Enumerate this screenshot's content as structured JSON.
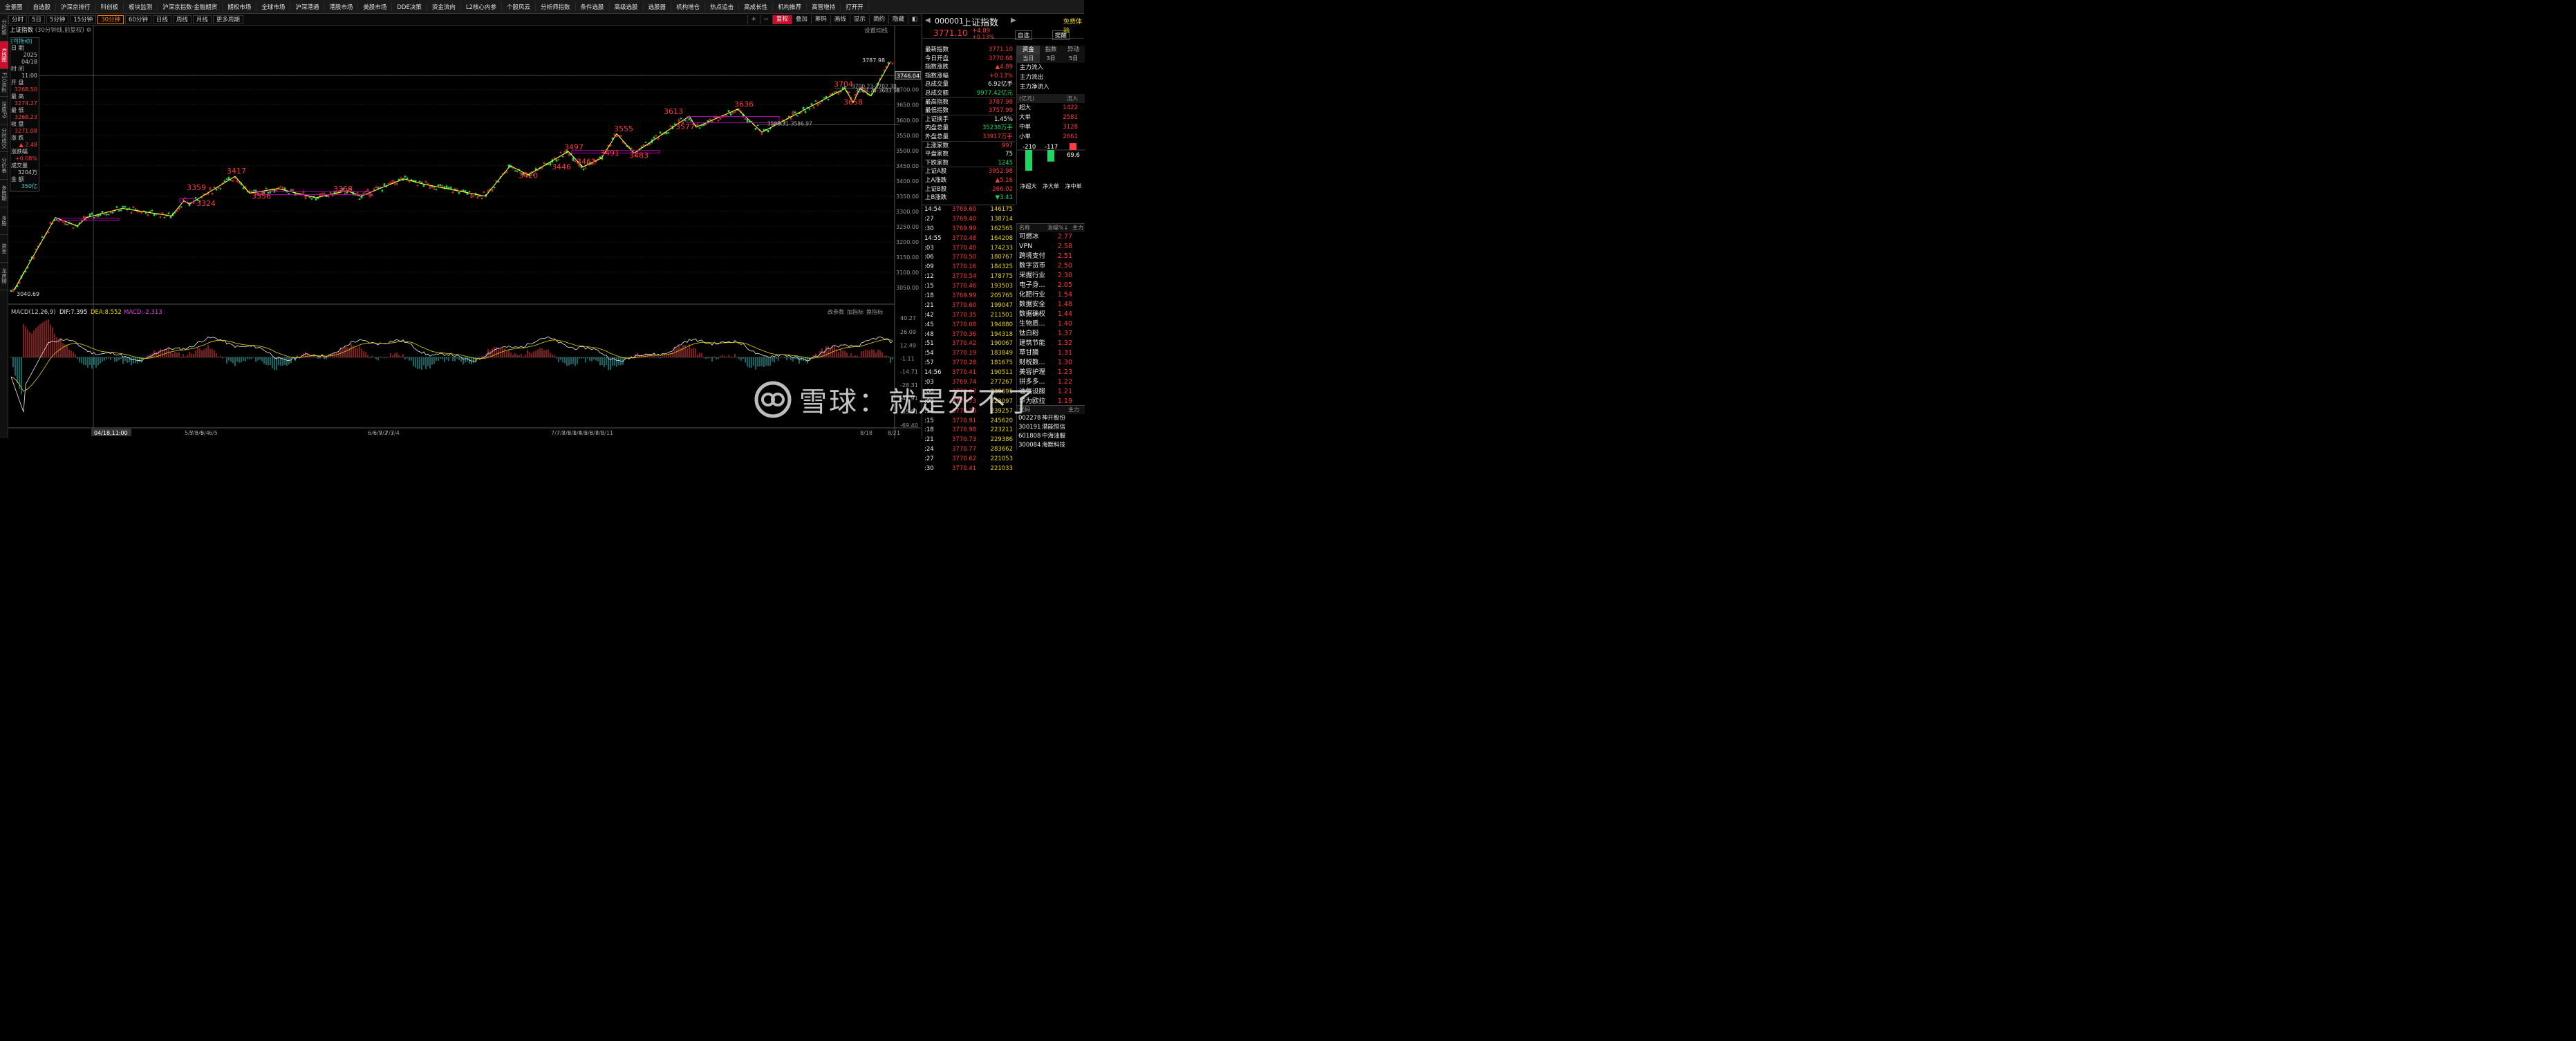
{
  "app": {
    "logo": "东方财富"
  },
  "menu": [
    "全景图",
    "自选股",
    "沪深京排行",
    "科创板",
    "板块监测",
    "沪深京指数·金融期货",
    "期权市场",
    "全球市场",
    "沪深港通",
    "港股市场",
    "美股市场",
    "DDE决策",
    "资金流向",
    "L2核心内参",
    "个股风云",
    "分析师指数",
    "条件选股",
    "高级选股",
    "选股器",
    "机构增仓",
    "热点追击",
    "高成长性",
    "机构推荐",
    "高管增持",
    "打开开"
  ],
  "side_tabs": [
    "分时图",
    "K线图",
    "F10资料",
    "深度F9",
    "分时成交",
    "分价表",
    "多周期",
    "多股",
    "资金",
    "龙虎榜"
  ],
  "periods": [
    "分时",
    "5日",
    "5分钟",
    "15分钟",
    "30分钟",
    "60分钟",
    "日线",
    "周线",
    "月线",
    "更多周期"
  ],
  "active_period": "30分钟",
  "tools": [
    "复权",
    "叠加",
    "筹码",
    "画线",
    "显示",
    "简约",
    "隐藏"
  ],
  "chart_title": "上证指数",
  "chart_subtitle": "(30分钟线,前复权)",
  "settings_label": "设置均线",
  "infobox": {
    "drag": "[可拖动]",
    "date_label": "日 期",
    "date_year": "2025",
    "date_md": "04/18",
    "time_label": "时 间",
    "time": "11:00",
    "open_label": "开 盘",
    "open": "3268.50",
    "high_label": "最 高",
    "high": "3274.27",
    "low_label": "最 低",
    "low": "3268.23",
    "close_label": "收 盘",
    "close": "3271.08",
    "chg_label": "涨 跌",
    "chg": "▲ 2.48",
    "pct_label": "涨跌幅",
    "pct": "+0.08%",
    "vol_label": "成交量",
    "vol": "3204万",
    "amt_label": "金 额",
    "amt": "350亿"
  },
  "price_axis": [
    "3750.00",
    "3700.00",
    "3650.00",
    "3600.00",
    "3550.00",
    "3500.00",
    "3450.00",
    "3400.00",
    "3350.00",
    "3300.00",
    "3250.00",
    "3200.00",
    "3150.00",
    "3100.00",
    "3050.00"
  ],
  "current_price_tag": "3746.04",
  "high_tag": "3787.98",
  "low_tag": "3040.69",
  "macd": {
    "title": "MACD(12,26,9)",
    "dif": "DIF:7.395",
    "dea": "DEA:8.552",
    "macd": "MACD:-2.313",
    "buttons": [
      "改参数",
      "加指标",
      "换指标"
    ],
    "axis": [
      "40.27",
      "26.09",
      "12.49",
      "-1.11",
      "-14.71",
      "-28.31",
      "-41.91",
      "-55.51",
      "-69.40"
    ]
  },
  "date_axis": [
    "04/18,11:00",
    "5/7",
    "5/8",
    "5/9",
    "6/4",
    "6/5",
    "6/6",
    "6/9",
    "7/2",
    "7/3",
    "7/4",
    "7/7",
    "7/8",
    "7/9",
    "8/1",
    "8/4",
    "8/5",
    "8/6",
    "8/7",
    "8/8",
    "8/11",
    "8/18",
    "8/21"
  ],
  "zig_labels": {
    "a": "3359",
    "b": "3324",
    "c": "3417",
    "d": "3356",
    "e": "3368",
    "f": "3420",
    "g": "3497",
    "h": "3446",
    "i": "3462",
    "j": "3555",
    "k": "3491",
    "l": "3483",
    "m": "3613",
    "n": "3577",
    "o": "3636",
    "p": "3704",
    "q": "3658",
    "r": "3700.23-3702.38",
    "s": "3683.74-3683.98",
    "t": "3583.31-3586.97"
  },
  "quote": {
    "code": "000001",
    "name": "上证指数",
    "price": "3771.10",
    "chg": "+4.89",
    "pct": "+0.13%",
    "btn_fav": "自选",
    "btn_alert": "提醒",
    "free_label": "免费体验"
  },
  "quote_rows": [
    {
      "label": "最新指数",
      "value": "3771.10",
      "color": "#ff3b3b"
    },
    {
      "label": "今日开盘",
      "value": "3770.68",
      "color": "#ff3b3b"
    },
    {
      "label": "指数涨跌",
      "value": "▲4.89",
      "color": "#ff3b3b"
    },
    {
      "label": "指数涨幅",
      "value": "+0.13%",
      "color": "#ff3b3b"
    },
    {
      "label": "总成交量",
      "value": "6.92亿手",
      "color": "#eeeeee"
    },
    {
      "label": "总成交额",
      "value": "9977.42亿元",
      "color": "#1ed760"
    },
    {
      "label": "最高指数",
      "value": "3787.98",
      "color": "#ff3b3b"
    },
    {
      "label": "最低指数",
      "value": "3757.99",
      "color": "#ff3b3b"
    },
    {
      "label": "上证换手",
      "value": "1.45%",
      "color": "#eeeeee"
    },
    {
      "label": "内盘总量",
      "value": "35238万手",
      "color": "#1ed760"
    },
    {
      "label": "外盘总量",
      "value": "33917万手",
      "color": "#ff3b3b"
    },
    {
      "label": "上涨家数",
      "value": "997",
      "color": "#ff3b3b"
    },
    {
      "label": "平盘家数",
      "value": "75",
      "color": "#eeeeee"
    },
    {
      "label": "下跌家数",
      "value": "1245",
      "color": "#1ed760"
    },
    {
      "label": "上证A股",
      "value": "3952.98",
      "color": "#ff3b3b"
    },
    {
      "label": "上A涨跌",
      "value": "▲5.16",
      "color": "#ff3b3b"
    },
    {
      "label": "上证B股",
      "value": "266.02",
      "color": "#ff3b3b"
    },
    {
      "label": "上B涨跌",
      "value": "▼3.41",
      "color": "#1ed760"
    }
  ],
  "flow_tabs": [
    "资金",
    "指数",
    "异动"
  ],
  "flow_subtabs": [
    "当日",
    "3日",
    "5日"
  ],
  "flow_rows": [
    "主力流入",
    "主力流出",
    "主力净流入"
  ],
  "flow_unit": "(亿元)",
  "flow_col": "流入",
  "flow_table": [
    {
      "label": "超大",
      "value": "1422"
    },
    {
      "label": "大单",
      "value": "2581"
    },
    {
      "label": "中单",
      "value": "3128"
    },
    {
      "label": "小单",
      "value": "2661"
    }
  ],
  "net_bars": {
    "values": [
      -210,
      -117,
      69.6
    ],
    "labels": [
      "-210",
      "-117",
      "69.6"
    ],
    "names": [
      "净超大",
      "净大单",
      "净中单"
    ]
  },
  "ticks": [
    {
      "t": "14:54",
      "p": "3769.60",
      "v": "146175"
    },
    {
      "t": ":27",
      "p": "3769.40",
      "v": "138714"
    },
    {
      "t": ":30",
      "p": "3769.99",
      "v": "162565"
    },
    {
      "t": "14:55",
      "p": "3770.48",
      "v": "164208"
    },
    {
      "t": ":03",
      "p": "3770.40",
      "v": "174233"
    },
    {
      "t": ":06",
      "p": "3770.50",
      "v": "180767"
    },
    {
      "t": ":09",
      "p": "3770.16",
      "v": "184325"
    },
    {
      "t": ":12",
      "p": "3770.54",
      "v": "178775"
    },
    {
      "t": ":15",
      "p": "3770.46",
      "v": "193503"
    },
    {
      "t": ":18",
      "p": "3769.99",
      "v": "205765"
    },
    {
      "t": ":21",
      "p": "3770.60",
      "v": "199047"
    },
    {
      "t": ":42",
      "p": "3770.35",
      "v": "211501"
    },
    {
      "t": ":45",
      "p": "3770.08",
      "v": "194880"
    },
    {
      "t": ":48",
      "p": "3770.36",
      "v": "194318"
    },
    {
      "t": ":51",
      "p": "3770.42",
      "v": "190067"
    },
    {
      "t": ":54",
      "p": "3770.19",
      "v": "183849"
    },
    {
      "t": ":57",
      "p": "3770.28",
      "v": "181675"
    },
    {
      "t": "14:56",
      "p": "3770.41",
      "v": "190511"
    },
    {
      "t": ":03",
      "p": "3769.74",
      "v": "277267"
    },
    {
      "t": ":06",
      "p": "3770.67",
      "v": "239695"
    },
    {
      "t": ":09",
      "p": "3770.73",
      "v": "223097"
    },
    {
      "t": ":12",
      "p": "3770.39",
      "v": "239257"
    },
    {
      "t": ":15",
      "p": "3770.91",
      "v": "245620"
    },
    {
      "t": ":18",
      "p": "3770.98",
      "v": "223211"
    },
    {
      "t": ":21",
      "p": "3770.73",
      "v": "229386"
    },
    {
      "t": ":24",
      "p": "3770.77",
      "v": "283662"
    },
    {
      "t": ":27",
      "p": "3770.62",
      "v": "221053"
    },
    {
      "t": ":30",
      "p": "3770.41",
      "v": "221033"
    }
  ],
  "sector_header": {
    "name": "名称",
    "pct": "涨幅%↓",
    "main": "主力"
  },
  "sectors": [
    {
      "n": "可燃冰",
      "p": "2.77"
    },
    {
      "n": "VPN",
      "p": "2.58"
    },
    {
      "n": "跨境支付",
      "p": "2.51"
    },
    {
      "n": "数字货币",
      "p": "2.50"
    },
    {
      "n": "采掘行业",
      "p": "2.30"
    },
    {
      "n": "电子身...",
      "p": "2.05"
    },
    {
      "n": "化肥行业",
      "p": "1.54"
    },
    {
      "n": "数据安全",
      "p": "1.48"
    },
    {
      "n": "数据确权",
      "p": "1.44"
    },
    {
      "n": "生物质...",
      "p": "1.40"
    },
    {
      "n": "钛白粉",
      "p": "1.37"
    },
    {
      "n": "建筑节能",
      "p": "1.32"
    },
    {
      "n": "草甘膦",
      "p": "1.31"
    },
    {
      "n": "财税数...",
      "p": "1.30"
    },
    {
      "n": "美容护理",
      "p": "1.23"
    },
    {
      "n": "拼多多...",
      "p": "1.22"
    },
    {
      "n": "油气设服",
      "p": "1.21"
    },
    {
      "n": "华为欧拉",
      "p": "1.19"
    }
  ],
  "stock_header": {
    "code": "代码",
    "main": "主力"
  },
  "stocks": [
    {
      "c": "002278",
      "n": "神开股份"
    },
    {
      "c": "300191",
      "n": "潜能恒信"
    },
    {
      "c": "601808",
      "n": "中海油服"
    },
    {
      "c": "300084",
      "n": "海默科技"
    }
  ],
  "watermark": "雪球：就是死不了",
  "colors": {
    "up": "#ff3b3b",
    "down": "#1ed760",
    "zig": "#ffff33",
    "box": "#c000c0",
    "accent": "#ff7d00"
  },
  "chart_data": {
    "type": "candlestick",
    "symbol": "上证指数",
    "period": "30分钟",
    "ylim": [
      3040.69,
      3787.98
    ],
    "zigzag_pivots": [
      3040.69,
      3285,
      3276,
      3359,
      3324,
      3417,
      3356,
      3368,
      3340,
      3420,
      3497,
      3446,
      3462,
      3555,
      3491,
      3483,
      3613,
      3577,
      3636,
      3560,
      3704,
      3658,
      3787.98
    ],
    "macd_ylim": [
      -69.4,
      40.27
    ]
  }
}
